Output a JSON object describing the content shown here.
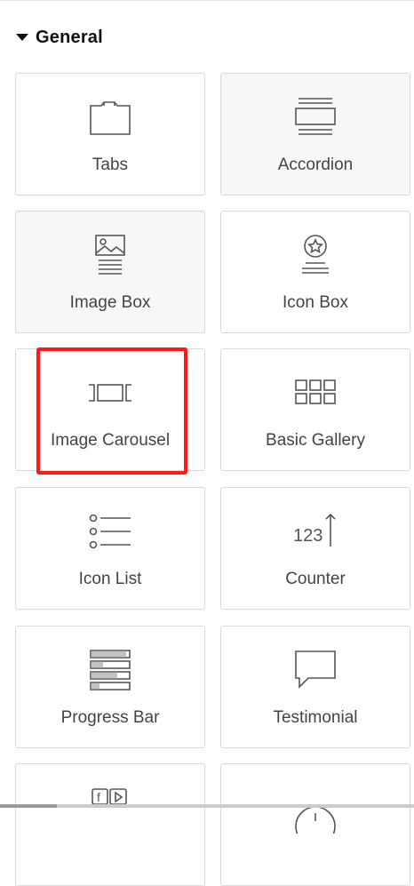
{
  "section": {
    "title": "General",
    "expanded": true
  },
  "widgets": [
    {
      "label": "Tabs",
      "icon": "tabs-icon"
    },
    {
      "label": "Accordion",
      "icon": "accordion-icon"
    },
    {
      "label": "Image Box",
      "icon": "image-box-icon"
    },
    {
      "label": "Icon Box",
      "icon": "icon-box-icon"
    },
    {
      "label": "Image Carousel",
      "icon": "image-carousel-icon"
    },
    {
      "label": "Basic Gallery",
      "icon": "basic-gallery-icon"
    },
    {
      "label": "Icon List",
      "icon": "icon-list-icon"
    },
    {
      "label": "Counter",
      "icon": "counter-icon",
      "icon_text": "123"
    },
    {
      "label": "Progress Bar",
      "icon": "progress-bar-icon"
    },
    {
      "label": "Testimonial",
      "icon": "testimonial-icon"
    },
    {
      "label": "",
      "icon": "social-icons-icon",
      "icon_text": "f"
    },
    {
      "label": "",
      "icon": "alert-icon"
    }
  ],
  "highlighted_widget": "Image Carousel",
  "colors": {
    "highlight": "#ff1a1a",
    "border": "#d9d9d9",
    "icon": "#555555",
    "shaded_card": "#f7f7f7"
  }
}
